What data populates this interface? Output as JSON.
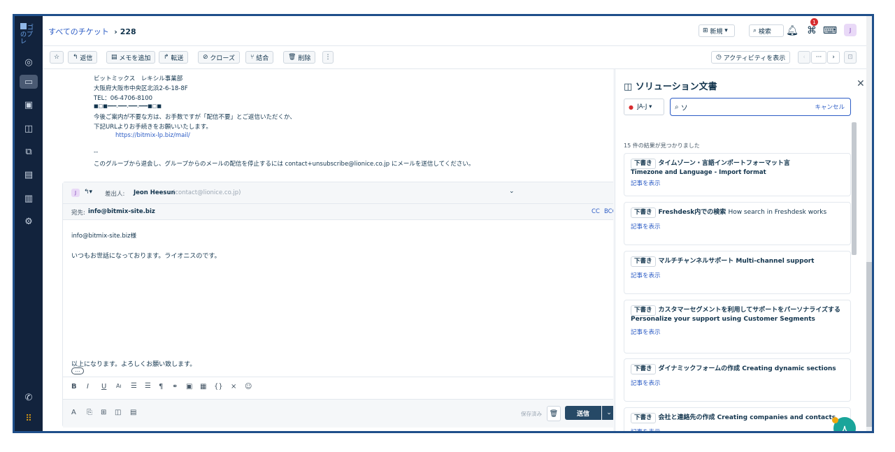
{
  "sidebar": {
    "logo_text": "ゴのプレ"
  },
  "header": {
    "breadcrumb_root": "すべてのチケット",
    "breadcrumb_separator": "›",
    "ticket_id": "228",
    "new_button": "新規",
    "search_button": "検索",
    "notification_count": "1",
    "avatar_initial": "J"
  },
  "toolbar": {
    "reply": "返信",
    "add_note": "メモを追加",
    "forward": "転送",
    "close": "クローズ",
    "merge": "結合",
    "delete": "削除",
    "show_activity": "アクティビティを表示"
  },
  "signature": {
    "lines": [
      "ビットミックス　レキシル事業部",
      "大阪府大阪市中央区北浜2-6-18-8F",
      "TEL：06-4706-8100",
      "■□■━━━.━━━.━━━.━━━■□■",
      "今後ご案内が不要な方は、お手数ですが「配信不要」とご返信いただくか、",
      "下記URLよりお手続きをお願いいたします。"
    ],
    "link": "https://bitmix-lp.biz/mail/",
    "separator": "--",
    "group_notice": "このグループから退会し、グループからのメールの配信を停止するには contact+unsubscribe@lionice.co.jp にメールを送信してください。"
  },
  "reply": {
    "avatar_initial": "J",
    "from_label": "差出人:",
    "from_name": "Jeon Heesun",
    "from_email": "(contact@lionice.co.jp)",
    "to_label": "宛先:",
    "to_address": "info@bitmix-site.biz",
    "cc": "CC",
    "bcc": "BCC",
    "body_greeting": "info@bitmix-site.biz様",
    "body_line1": "いつもお世話になっております。ライオニスのです。",
    "body_closing": "以上になります。よろしくお願い致します。",
    "ellipsis": "…",
    "saved_label": "保存済み",
    "send_button": "送信"
  },
  "panel": {
    "title": "ソリューション文書",
    "lang": "JA-J",
    "search_value": "ソ",
    "cancel": "キャンセル",
    "result_count": "15 件の結果が見つかりました",
    "draft_label": "下書き",
    "view_label": "記事を表示",
    "results": [
      {
        "ja": "タイムゾーン・言語インポートフォーマット言",
        "en": "Timezone and Language - Import format"
      },
      {
        "ja": "Freshdesk内での検索",
        "en": "How search in Freshdesk works"
      },
      {
        "ja": "マルチチャンネルサポート",
        "en": "Multi-channel support"
      },
      {
        "ja": "カスタマーセグメントを利用してサポートをパーソナライズする",
        "en": "Personalize your support using Customer Segments"
      },
      {
        "ja": "ダイナミックフォームの作成",
        "en": "Creating dynamic sections"
      },
      {
        "ja": "会社と連絡先の作成",
        "en": "Creating companies and contacts"
      }
    ]
  }
}
